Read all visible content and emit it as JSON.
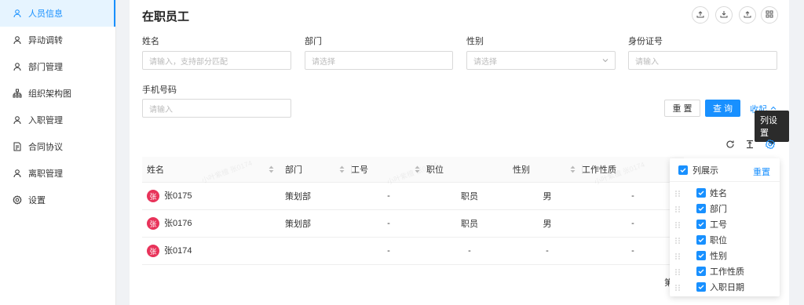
{
  "sidebar": {
    "items": [
      {
        "label": "人员信息",
        "icon": "user-icon",
        "active": true
      },
      {
        "label": "异动调转",
        "icon": "user-icon",
        "active": false
      },
      {
        "label": "部门管理",
        "icon": "user-icon",
        "active": false
      },
      {
        "label": "组织架构图",
        "icon": "org-chart-icon",
        "active": false
      },
      {
        "label": "入职管理",
        "icon": "user-icon",
        "active": false
      },
      {
        "label": "合同协议",
        "icon": "contract-icon",
        "active": false
      },
      {
        "label": "离职管理",
        "icon": "user-icon",
        "active": false
      },
      {
        "label": "设置",
        "icon": "gear-icon",
        "active": false
      }
    ]
  },
  "header": {
    "title": "在职员工",
    "actions": [
      "import-icon",
      "download-icon",
      "export-icon",
      "grid-icon"
    ]
  },
  "filters": {
    "name": {
      "label": "姓名",
      "placeholder": "请输入，支持部分匹配"
    },
    "dept": {
      "label": "部门",
      "placeholder": "请选择"
    },
    "gender": {
      "label": "性别",
      "placeholder": "请选择"
    },
    "idcard": {
      "label": "身份证号",
      "placeholder": "请输入"
    },
    "phone": {
      "label": "手机号码",
      "placeholder": "请输入"
    },
    "reset_label": "重 置",
    "query_label": "查 询",
    "collapse_label": "收起"
  },
  "toolbar": {
    "tooltip": "列设置",
    "icons": [
      "refresh-icon",
      "density-icon",
      "settings-icon"
    ]
  },
  "table": {
    "columns": [
      "姓名",
      "部门",
      "工号",
      "职位",
      "性别",
      "工作性质"
    ],
    "rows": [
      {
        "avatar": "张",
        "name": "张0175",
        "dept": "策划部",
        "no": "-",
        "position": "职员",
        "gender": "男",
        "nature": "-"
      },
      {
        "avatar": "张",
        "name": "张0176",
        "dept": "策划部",
        "no": "-",
        "position": "职员",
        "gender": "男",
        "nature": "-"
      },
      {
        "avatar": "张",
        "name": "张0174",
        "dept": "",
        "no": "-",
        "position": "-",
        "gender": "-",
        "nature": "-"
      }
    ]
  },
  "watermark": "小叶紫檀 张0174",
  "column_settings": {
    "header_label": "列展示",
    "reset_label": "重置",
    "items": [
      "姓名",
      "部门",
      "工号",
      "职位",
      "性别",
      "工作性质",
      "入职日期"
    ]
  },
  "pagination": {
    "prefix": "第"
  },
  "colors": {
    "accent": "#1890ff",
    "avatar": "#e8335a"
  }
}
